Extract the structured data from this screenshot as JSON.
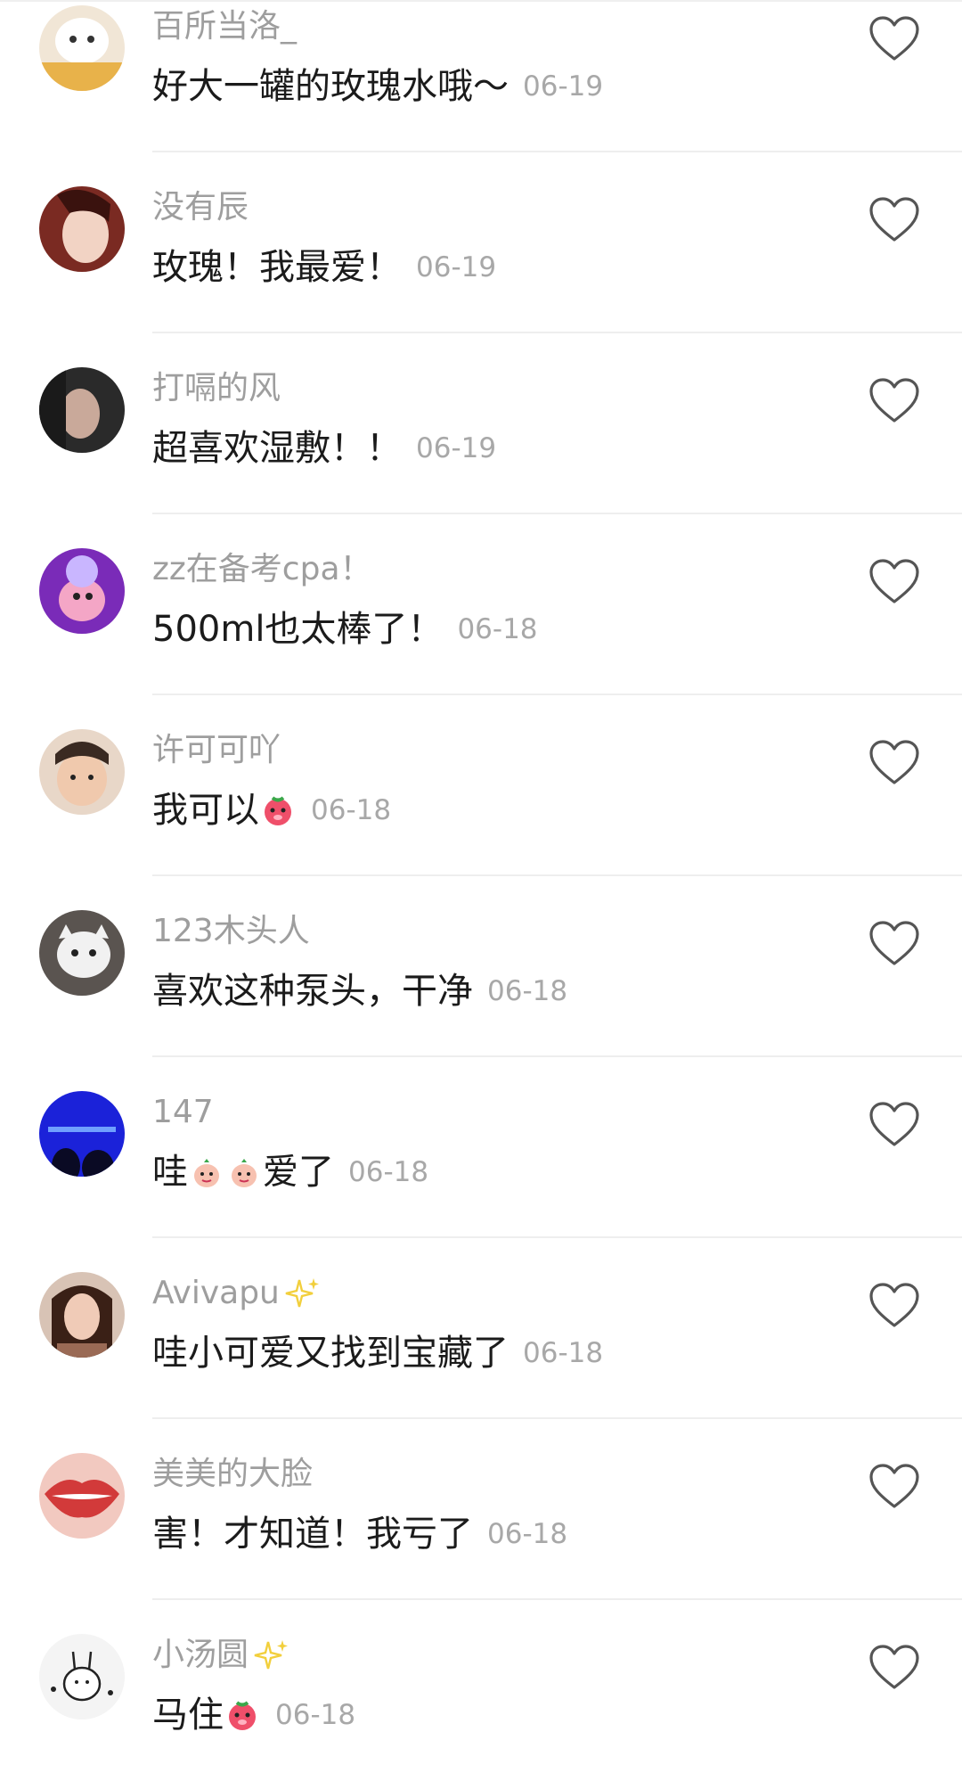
{
  "comments": [
    {
      "username": "百所当洛_",
      "text": "好大一罐的玫瑰水哦～",
      "date": "06-19",
      "avatar_color": "#f1e6d6",
      "avatar_accent": "#e8b24a"
    },
    {
      "username": "没有辰",
      "text": "玫瑰！我最爱！",
      "date": "06-19",
      "avatar_color": "#7a2a22",
      "avatar_accent": "#f2d3c4"
    },
    {
      "username": "打嗝的风",
      "text": "超喜欢湿敷！！",
      "date": "06-19",
      "avatar_color": "#2a2a2a",
      "avatar_accent": "#c9a99a"
    },
    {
      "username": "zz在备考cpa！",
      "text": "500ml也太棒了！",
      "date": "06-18",
      "avatar_color": "#7a2bb8",
      "avatar_accent": "#f4a6c6"
    },
    {
      "username": "许可可吖",
      "text": "我可以",
      "date": "06-18",
      "avatar_color": "#d9b8a3",
      "avatar_accent": "#3a2a22"
    },
    {
      "username": "123木头人",
      "text": "喜欢这种泵头，干净",
      "date": "06-18",
      "avatar_color": "#5a5450",
      "avatar_accent": "#f1f1f1"
    },
    {
      "username": "147",
      "text_parts": [
        "哇",
        "爱了"
      ],
      "date": "06-18",
      "avatar_color": "#1b22d9",
      "avatar_accent": "#0a0a24"
    },
    {
      "username": "Avivapu",
      "text": "哇小可爱又找到宝藏了",
      "date": "06-18",
      "avatar_color": "#9a6a55",
      "avatar_accent": "#3a2016"
    },
    {
      "username": "美美的大脸",
      "text": "害！才知道！我亏了",
      "date": "06-18",
      "avatar_color": "#d23a3a",
      "avatar_accent": "#f2c9c0"
    },
    {
      "username": "小汤圆",
      "text": "马住",
      "date": "06-18",
      "avatar_color": "#f4f4f4",
      "avatar_accent": "#222222"
    }
  ],
  "icons": {
    "like": "heart-outline-icon",
    "emoji_tongue": "smiling-strawberry-emoji",
    "emoji_peach": "peach-bag-emoji",
    "sparkle": "sparkle-icon"
  },
  "colors": {
    "username": "#9e9e9e",
    "text": "#1b1b1b",
    "date": "#a8a8a8",
    "sparkle": "#f2cf3c",
    "divider": "#eeeeee"
  }
}
